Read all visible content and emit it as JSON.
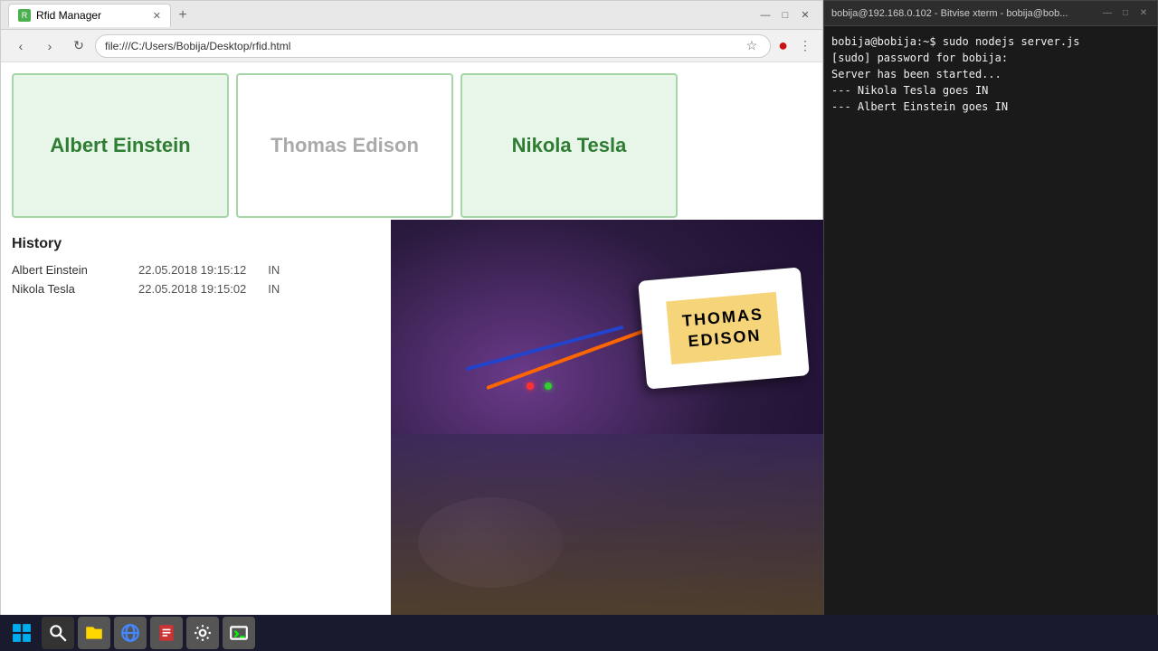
{
  "browser": {
    "tab_label": "Rfid Manager",
    "tab_favicon": "R",
    "address": "file:///C:/Users/Bobija/Desktop/rfid.html",
    "cards": [
      {
        "name": "Albert Einstein",
        "active": true
      },
      {
        "name": "Thomas Edison",
        "active": false
      },
      {
        "name": "Nikola Tesla",
        "active": true
      }
    ],
    "history_title": "History",
    "history_entries": [
      {
        "name": "Albert Einstein",
        "time": "22.05.2018 19:15:12",
        "status": "IN"
      },
      {
        "name": "Nikola Tesla",
        "time": "22.05.2018 19:15:02",
        "status": "IN"
      }
    ]
  },
  "terminal": {
    "title": "bobija@192.168.0.102 - Bitvise xterm - bobija@bob...",
    "lines": [
      "bobija@bobija:~$ sudo nodejs server.js",
      "[sudo] password for bobija:",
      "Server has been started...",
      "--- Nikola Tesla goes IN",
      "--- Albert Einstein goes IN"
    ]
  },
  "physical_card": {
    "line1": "THOMAS",
    "line2": "EDISON"
  },
  "taskbar": {
    "icons": [
      "⊞",
      "🔎",
      "📁",
      "🌐",
      "📋",
      "🔧",
      "💻"
    ]
  }
}
